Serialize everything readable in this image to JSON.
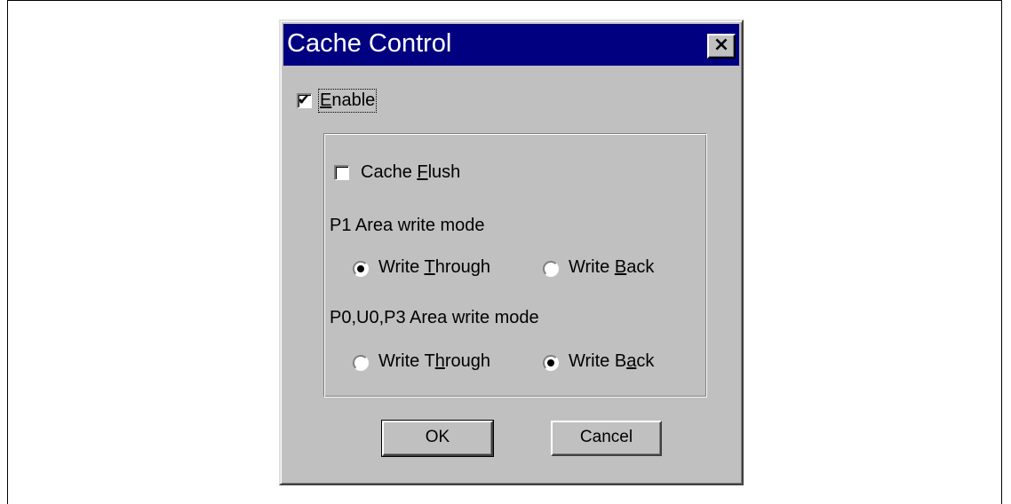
{
  "window": {
    "title": "Cache Control",
    "close_glyph": "×"
  },
  "enable": {
    "label_prefix": "",
    "label_mnemonic": "E",
    "label_suffix": "nable",
    "checked": true
  },
  "cache_flush": {
    "label_prefix": "Cache ",
    "label_mnemonic": "F",
    "label_suffix": "lush",
    "checked": false
  },
  "p1_area": {
    "heading": "P1 Area write mode",
    "write_through": {
      "label_prefix": "Write ",
      "label_mnemonic": "T",
      "label_suffix": "hrough",
      "selected": true
    },
    "write_back": {
      "label_prefix": "Write ",
      "label_mnemonic": "B",
      "label_suffix": "ack",
      "selected": false
    }
  },
  "p0_area": {
    "heading": "P0,U0,P3 Area write mode",
    "write_through": {
      "label_prefix": "Write T",
      "label_mnemonic": "h",
      "label_suffix": "rough",
      "selected": false
    },
    "write_back": {
      "label_prefix": "Write B",
      "label_mnemonic": "a",
      "label_suffix": "ck",
      "selected": true
    }
  },
  "buttons": {
    "ok": "OK",
    "cancel": "Cancel"
  }
}
